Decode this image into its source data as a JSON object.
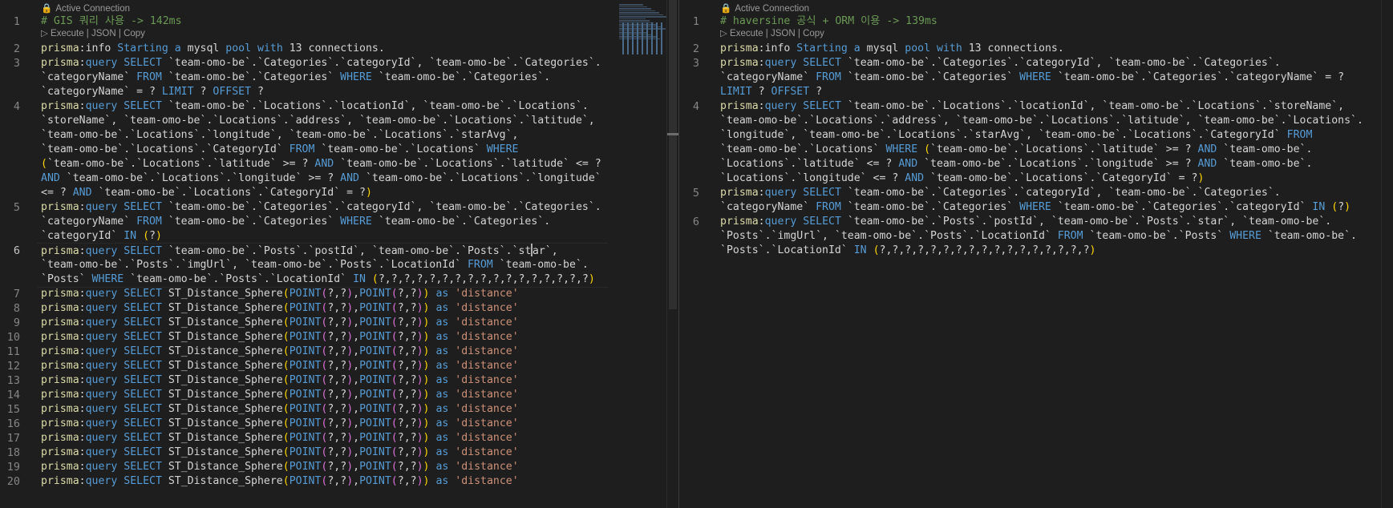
{
  "lens": {
    "active_connection": "Active Connection",
    "execute": "Execute",
    "json": "JSON",
    "copy": "Copy",
    "sep": " | "
  },
  "left": {
    "line_numbers": [
      "1",
      "2",
      "3",
      "4",
      "5",
      "6",
      "7",
      "8",
      "9",
      "10",
      "11",
      "12",
      "13",
      "14",
      "15",
      "16",
      "17",
      "18",
      "19",
      "20"
    ],
    "comment": "# GIS 쿼리 사용 -> 142ms",
    "info_line": "prisma:info Starting a mysql pool with 13 connections.",
    "q3": [
      "prisma:query SELECT `team-omo-be`.`Categories`.`categoryId`, `team-omo-be`.`Categories`.",
      "`categoryName` FROM `team-omo-be`.`Categories` WHERE `team-omo-be`.`Categories`.",
      "`categoryName` = ? LIMIT ? OFFSET ?"
    ],
    "q4": [
      "prisma:query SELECT `team-omo-be`.`Locations`.`locationId`, `team-omo-be`.`Locations`.",
      "`storeName`, `team-omo-be`.`Locations`.`address`, `team-omo-be`.`Locations`.`latitude`,",
      "`team-omo-be`.`Locations`.`longitude`, `team-omo-be`.`Locations`.`starAvg`,",
      "`team-omo-be`.`Locations`.`CategoryId` FROM `team-omo-be`.`Locations` WHERE",
      "(`team-omo-be`.`Locations`.`latitude` >= ? AND `team-omo-be`.`Locations`.`latitude` <= ?",
      "AND `team-omo-be`.`Locations`.`longitude` >= ? AND `team-omo-be`.`Locations`.`longitude`",
      "<= ? AND `team-omo-be`.`Locations`.`CategoryId` = ?)"
    ],
    "q5": [
      "prisma:query SELECT `team-omo-be`.`Categories`.`categoryId`, `team-omo-be`.`Categories`.",
      "`categoryName` FROM `team-omo-be`.`Categories` WHERE `team-omo-be`.`Categories`.",
      "`categoryId` IN (?)"
    ],
    "q6": [
      "prisma:query SELECT `team-omo-be`.`Posts`.`postId`, `team-omo-be`.`Posts`.`star`,",
      "`team-omo-be`.`Posts`.`imgUrl`, `team-omo-be`.`Posts`.`LocationId` FROM `team-omo-be`.",
      "`Posts` WHERE `team-omo-be`.`Posts`.`LocationId` IN (?,?,?,?,?,?,?,?,?,?,?,?,?,?,?,?,?)"
    ],
    "distance_line": "prisma:query SELECT ST_Distance_Sphere(POINT(?,?),POINT(?,?)) as 'distance'"
  },
  "right": {
    "line_numbers": [
      "1",
      "2",
      "3",
      "4",
      "5",
      "6"
    ],
    "comment": "# haversine 공식 + ORM 이용 -> 139ms",
    "info_line": "prisma:info Starting a mysql pool with 13 connections.",
    "q3": [
      "prisma:query SELECT `team-omo-be`.`Categories`.`categoryId`, `team-omo-be`.`Categories`.",
      "`categoryName` FROM `team-omo-be`.`Categories` WHERE `team-omo-be`.`Categories`.`categoryName` = ?",
      "LIMIT ? OFFSET ?"
    ],
    "q4": [
      "prisma:query SELECT `team-omo-be`.`Locations`.`locationId`, `team-omo-be`.`Locations`.`storeName`,",
      "`team-omo-be`.`Locations`.`address`, `team-omo-be`.`Locations`.`latitude`, `team-omo-be`.`Locations`.",
      "`longitude`, `team-omo-be`.`Locations`.`starAvg`, `team-omo-be`.`Locations`.`CategoryId` FROM",
      "`team-omo-be`.`Locations` WHERE (`team-omo-be`.`Locations`.`latitude` >= ? AND `team-omo-be`.",
      "`Locations`.`latitude` <= ? AND `team-omo-be`.`Locations`.`longitude` >= ? AND `team-omo-be`.",
      "`Locations`.`longitude` <= ? AND `team-omo-be`.`Locations`.`CategoryId` = ?)"
    ],
    "q5": [
      "prisma:query SELECT `team-omo-be`.`Categories`.`categoryId`, `team-omo-be`.`Categories`.",
      "`categoryName` FROM `team-omo-be`.`Categories` WHERE `team-omo-be`.`Categories`.`categoryId` IN (?)"
    ],
    "q6": [
      "prisma:query SELECT `team-omo-be`.`Posts`.`postId`, `team-omo-be`.`Posts`.`star`, `team-omo-be`.",
      "`Posts`.`imgUrl`, `team-omo-be`.`Posts`.`LocationId` FROM `team-omo-be`.`Posts` WHERE `team-omo-be`.",
      "`Posts`.`LocationId` IN (?,?,?,?,?,?,?,?,?,?,?,?,?,?,?,?,?)"
    ]
  }
}
